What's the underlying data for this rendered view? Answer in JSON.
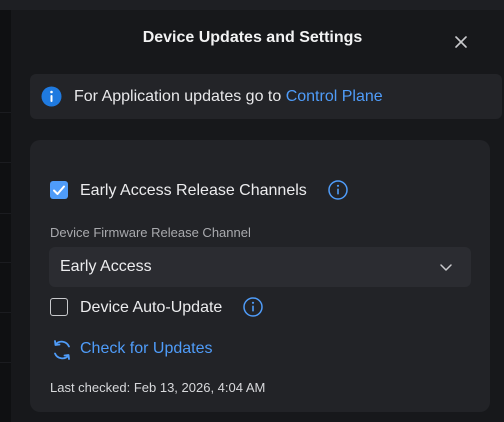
{
  "dialog": {
    "title": "Device Updates and Settings",
    "close_icon": "close-icon"
  },
  "banner": {
    "icon": "info-circle-icon",
    "text": "For Application updates go to ",
    "link": "Control Plane"
  },
  "settings": {
    "early_access": {
      "label": "Early Access Release Channels",
      "checked": true,
      "info_icon": "info-icon"
    },
    "firmware_channel": {
      "label": "Device Firmware Release Channel",
      "selected": "Early Access",
      "chevron_icon": "chevron-down-icon"
    },
    "auto_update": {
      "label": "Device Auto-Update",
      "checked": false,
      "info_icon": "info-icon"
    },
    "check_updates": {
      "label": "Check for Updates",
      "icon": "refresh-icon"
    },
    "last_checked": "Last checked: Feb 13, 2026, 4:04 AM"
  },
  "colors": {
    "accent": "#4f9cf9",
    "background": "#17181b",
    "card": "#222327"
  }
}
